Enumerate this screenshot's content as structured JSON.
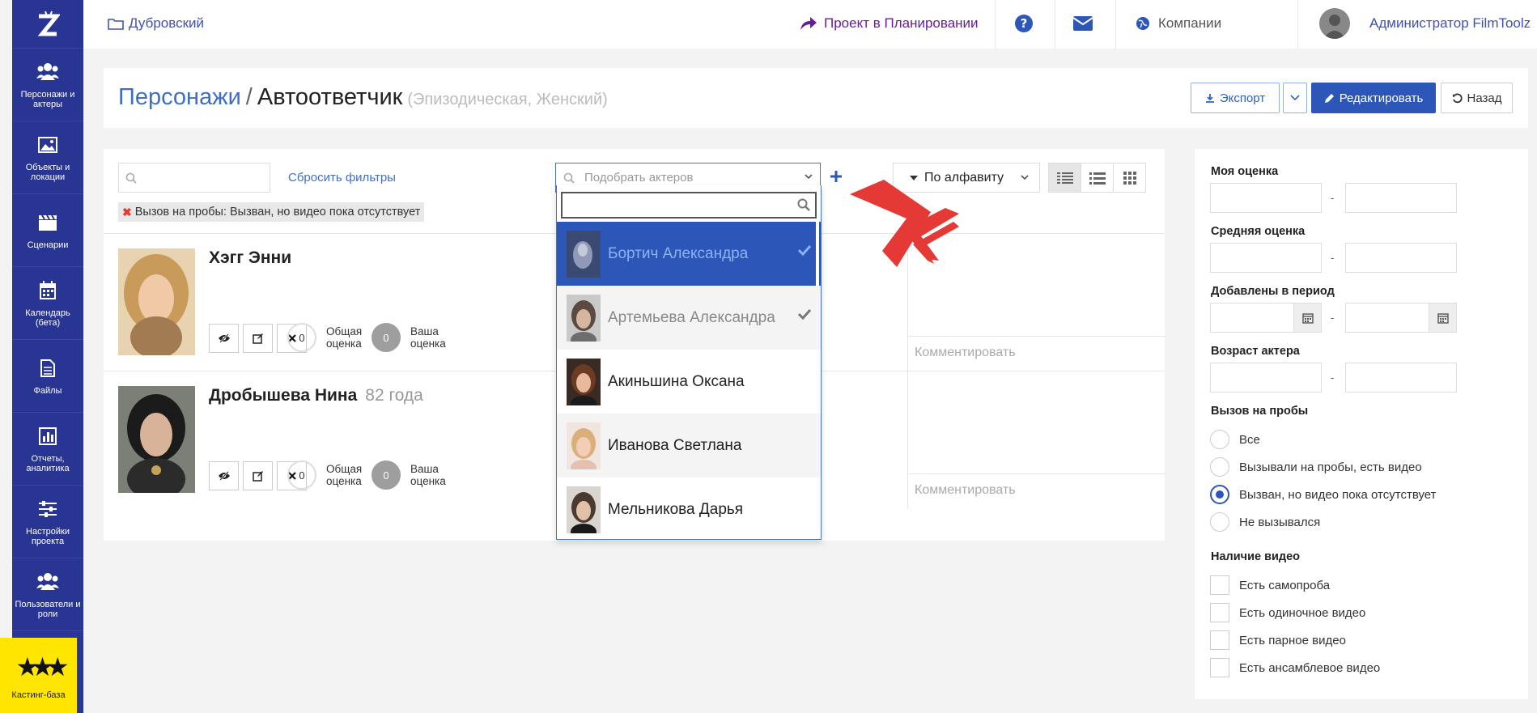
{
  "sidebar": {
    "items": [
      {
        "label": "Персонажи и актеры",
        "icon": "users-icon"
      },
      {
        "label": "Объекты и локации",
        "icon": "image-icon"
      },
      {
        "label": "Сценарии",
        "icon": "clapperboard-icon"
      },
      {
        "label": "Календарь (бета)",
        "icon": "calendar-icon"
      },
      {
        "label": "Файлы",
        "icon": "file-icon"
      },
      {
        "label": "Отчеты, аналитика",
        "icon": "chart-icon"
      },
      {
        "label": "Настройки проекта",
        "icon": "sliders-icon"
      },
      {
        "label": "Пользователи и роли",
        "icon": "users-icon"
      }
    ],
    "bottom_label": "Кастинг-база"
  },
  "topbar": {
    "project": "Дубровский",
    "status": "Проект в Планировании",
    "companies": "Компании",
    "user": "Администратор FilmToolz"
  },
  "header": {
    "crumb": "Персонажи",
    "separator": "/",
    "name": "Автоответчик",
    "meta": "(Эпизодическая, Женский)",
    "export_label": "Экспорт",
    "edit_label": "Редактировать",
    "back_label": "Назад"
  },
  "toolbar": {
    "reset_filters": "Сбросить фильтры",
    "picker_placeholder": "Подобрать актеров",
    "sort_label": "По алфавиту",
    "active_filter": "Вызов на пробы:  Вызван, но видео пока отсутствует"
  },
  "actors": [
    {
      "name": "Хэгг Энни",
      "age": "",
      "total_rating": "0",
      "my_rating": "0",
      "total_label": "Общая оценка",
      "my_label": "Ваша оценка",
      "comment_placeholder": "Комментировать"
    },
    {
      "name": "Дробышева Нина",
      "age": "82 года",
      "total_rating": "0",
      "my_rating": "0",
      "total_label": "Общая оценка",
      "my_label": "Ваша оценка",
      "comment_placeholder": "Комментировать"
    }
  ],
  "dropdown": {
    "items": [
      {
        "name": "Бортич Александра",
        "checked": true
      },
      {
        "name": "Артемьева Александра",
        "checked": true
      },
      {
        "name": "Акиньшина Оксана",
        "checked": false
      },
      {
        "name": "Иванова Светлана",
        "checked": false
      },
      {
        "name": "Мельникова Дарья",
        "checked": false
      }
    ]
  },
  "filters": {
    "my_rating": "Моя оценка",
    "avg_rating": "Средняя оценка",
    "added_period": "Добавлены в период",
    "actor_age": "Возраст актера",
    "dash": "-",
    "audition_title": "Вызов на пробы",
    "audition_options": [
      "Все",
      "Вызывали на пробы, есть видео",
      "Вызван, но видео пока отсутствует",
      "Не вызывался"
    ],
    "audition_selected": 2,
    "video_title": "Наличие видео",
    "video_options": [
      "Есть самопроба",
      "Есть одиночное видео",
      "Есть парное видео",
      "Есть ансамблевое видео"
    ]
  },
  "colors": {
    "sidebar": "#283593",
    "primary": "#2c56b8",
    "accent_yellow": "#ffe600",
    "arrow_red": "#e53935"
  }
}
